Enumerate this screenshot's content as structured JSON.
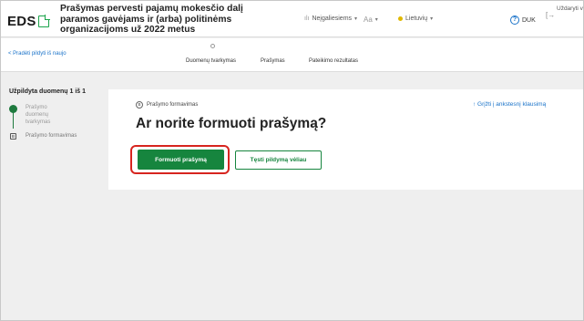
{
  "header": {
    "logo": "EDS",
    "title": "Prašymas pervesti pajamų mokesčio dalį paramos gavėjams ir (arba) politinėms organizacijoms už 2022 metus",
    "accessibility": "Neįgaliesiems",
    "font_size": "Aa",
    "language": "Lietuvių",
    "faq": "DUK",
    "logout": "Uždaryti vedl"
  },
  "stepsbar": {
    "back_link": "< Pradėti pildyti iš naujo",
    "steps": [
      "Duomenų tvarkymas",
      "Prašymas",
      "Pateikimo rezultatas"
    ]
  },
  "sidebar": {
    "title": "Užpildyta duomenų 1 iš 1",
    "items": [
      {
        "label": "Prašymo duomenų tvarkymas",
        "status": "done"
      },
      {
        "label": "Prašymo formavimas",
        "number": "B"
      }
    ]
  },
  "main": {
    "step_badge": "B",
    "step_label": "Prašymo formavimas",
    "back_link": "↑ Grįžti į ankstesnį klausimą",
    "question": "Ar norite formuoti prašymą?",
    "primary_button": "Formuoti prašymą",
    "secondary_button": "Tęsti pildymą vėliau"
  },
  "colors": {
    "accent_green": "#16853e",
    "link_blue": "#1a73c9",
    "highlight_red": "#d7251f"
  }
}
